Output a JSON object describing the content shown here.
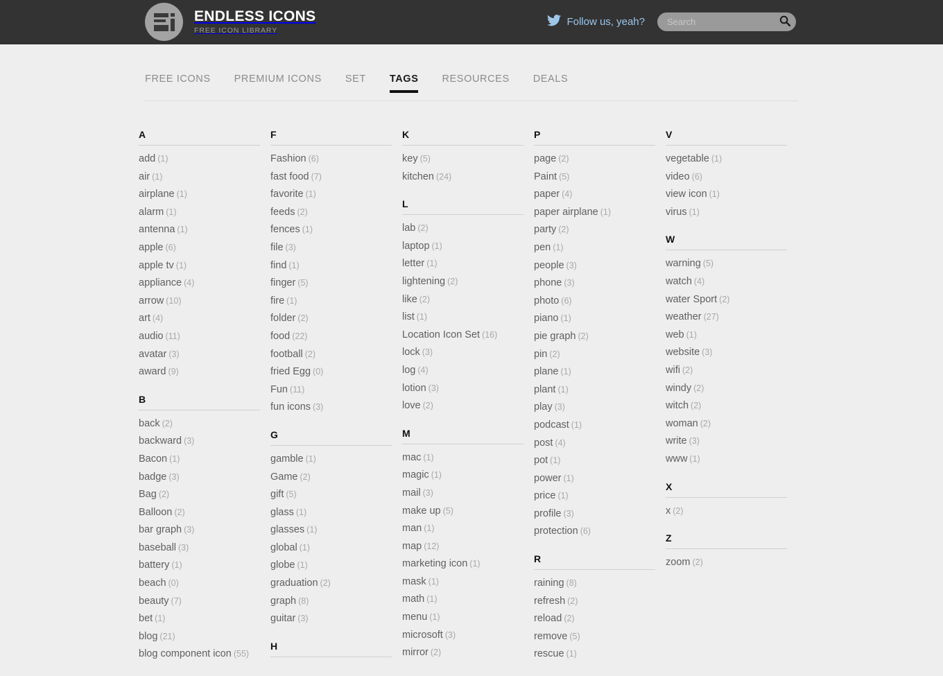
{
  "header": {
    "brand_title": "ENDLESS ICONS",
    "brand_subtitle": "FREE ICON LIBRARY",
    "logo_icon": "ei-monogram-icon",
    "twitter_icon": "twitter-bird-icon",
    "twitter_text": "Follow us, yeah?",
    "search_placeholder": "Search",
    "search_value": "",
    "search_icon": "search-icon",
    "colors": {
      "bar_background": "#333333",
      "logo_background": "#a3a3a3",
      "twitter_text": "#9ec6e8",
      "search_background": "#9a9a9a"
    }
  },
  "nav": {
    "items": [
      {
        "label": "FREE ICONS",
        "active": false
      },
      {
        "label": "PREMIUM ICONS",
        "active": false
      },
      {
        "label": "SET",
        "active": false
      },
      {
        "label": "TAGS",
        "active": true
      },
      {
        "label": "RESOURCES",
        "active": false
      },
      {
        "label": "DEALS",
        "active": false
      }
    ],
    "active_label": "TAGS",
    "active_underline_color": "#111111"
  },
  "page": {
    "background": "#eeeeee",
    "text_color": "#5f5f5f",
    "count_color": "#a8a8a8"
  },
  "columns": [
    {
      "blocks": [
        {
          "letter": "A",
          "tags": [
            {
              "name": "add",
              "count": "(1)"
            },
            {
              "name": "air",
              "count": "(1)"
            },
            {
              "name": "airplane",
              "count": "(1)"
            },
            {
              "name": "alarm",
              "count": "(1)"
            },
            {
              "name": "antenna",
              "count": "(1)"
            },
            {
              "name": "apple",
              "count": "(6)"
            },
            {
              "name": "apple tv",
              "count": "(1)"
            },
            {
              "name": "appliance",
              "count": "(4)"
            },
            {
              "name": "arrow",
              "count": "(10)"
            },
            {
              "name": "art",
              "count": "(4)"
            },
            {
              "name": "audio",
              "count": "(11)"
            },
            {
              "name": "avatar",
              "count": "(3)"
            },
            {
              "name": "award",
              "count": "(9)"
            }
          ]
        },
        {
          "letter": "B",
          "tags": [
            {
              "name": "back",
              "count": "(2)"
            },
            {
              "name": "backward",
              "count": "(3)"
            },
            {
              "name": "Bacon",
              "count": "(1)"
            },
            {
              "name": "badge",
              "count": "(3)"
            },
            {
              "name": "Bag",
              "count": "(2)"
            },
            {
              "name": "Balloon",
              "count": "(2)"
            },
            {
              "name": "bar graph",
              "count": "(3)"
            },
            {
              "name": "baseball",
              "count": "(3)"
            },
            {
              "name": "battery",
              "count": "(1)"
            },
            {
              "name": "beach",
              "count": "(0)"
            },
            {
              "name": "beauty",
              "count": "(7)"
            },
            {
              "name": "bet",
              "count": "(1)"
            },
            {
              "name": "blog",
              "count": "(21)"
            },
            {
              "name": "blog component icon",
              "count": "(55)"
            }
          ]
        }
      ]
    },
    {
      "blocks": [
        {
          "letter": "F",
          "tags": [
            {
              "name": "Fashion",
              "count": "(6)"
            },
            {
              "name": "fast food",
              "count": "(7)"
            },
            {
              "name": "favorite",
              "count": "(1)"
            },
            {
              "name": "feeds",
              "count": "(2)"
            },
            {
              "name": "fences",
              "count": "(1)"
            },
            {
              "name": "file",
              "count": "(3)"
            },
            {
              "name": "find",
              "count": "(1)"
            },
            {
              "name": "finger",
              "count": "(5)"
            },
            {
              "name": "fire",
              "count": "(1)"
            },
            {
              "name": "folder",
              "count": "(2)"
            },
            {
              "name": "food",
              "count": "(22)"
            },
            {
              "name": "football",
              "count": "(2)"
            },
            {
              "name": "fried Egg",
              "count": "(0)"
            },
            {
              "name": "Fun",
              "count": "(11)"
            },
            {
              "name": "fun icons",
              "count": "(3)"
            }
          ]
        },
        {
          "letter": "G",
          "tags": [
            {
              "name": "gamble",
              "count": "(1)"
            },
            {
              "name": "Game",
              "count": "(2)"
            },
            {
              "name": "gift",
              "count": "(5)"
            },
            {
              "name": "glass",
              "count": "(1)"
            },
            {
              "name": "glasses",
              "count": "(1)"
            },
            {
              "name": "global",
              "count": "(1)"
            },
            {
              "name": "globe",
              "count": "(1)"
            },
            {
              "name": "graduation",
              "count": "(2)"
            },
            {
              "name": "graph",
              "count": "(8)"
            },
            {
              "name": "guitar",
              "count": "(3)"
            }
          ]
        },
        {
          "letter": "H",
          "tags": []
        }
      ]
    },
    {
      "blocks": [
        {
          "letter": "K",
          "tags": [
            {
              "name": "key",
              "count": "(5)"
            },
            {
              "name": "kitchen",
              "count": "(24)"
            }
          ]
        },
        {
          "letter": "L",
          "tags": [
            {
              "name": "lab",
              "count": "(2)"
            },
            {
              "name": "laptop",
              "count": "(1)"
            },
            {
              "name": "letter",
              "count": "(1)"
            },
            {
              "name": "lightening",
              "count": "(2)"
            },
            {
              "name": "like",
              "count": "(2)"
            },
            {
              "name": "list",
              "count": "(1)"
            },
            {
              "name": "Location Icon Set",
              "count": "(16)"
            },
            {
              "name": "lock",
              "count": "(3)"
            },
            {
              "name": "log",
              "count": "(4)"
            },
            {
              "name": "lotion",
              "count": "(3)"
            },
            {
              "name": "love",
              "count": "(2)"
            }
          ]
        },
        {
          "letter": "M",
          "tags": [
            {
              "name": "mac",
              "count": "(1)"
            },
            {
              "name": "magic",
              "count": "(1)"
            },
            {
              "name": "mail",
              "count": "(3)"
            },
            {
              "name": "make up",
              "count": "(5)"
            },
            {
              "name": "man",
              "count": "(1)"
            },
            {
              "name": "map",
              "count": "(12)"
            },
            {
              "name": "marketing icon",
              "count": "(1)"
            },
            {
              "name": "mask",
              "count": "(1)"
            },
            {
              "name": "math",
              "count": "(1)"
            },
            {
              "name": "menu",
              "count": "(1)"
            },
            {
              "name": "microsoft",
              "count": "(3)"
            },
            {
              "name": "mirror",
              "count": "(2)"
            }
          ]
        }
      ]
    },
    {
      "blocks": [
        {
          "letter": "P",
          "tags": [
            {
              "name": "page",
              "count": "(2)"
            },
            {
              "name": "Paint",
              "count": "(5)"
            },
            {
              "name": "paper",
              "count": "(4)"
            },
            {
              "name": "paper airplane",
              "count": "(1)"
            },
            {
              "name": "party",
              "count": "(2)"
            },
            {
              "name": "pen",
              "count": "(1)"
            },
            {
              "name": "people",
              "count": "(3)"
            },
            {
              "name": "phone",
              "count": "(3)"
            },
            {
              "name": "photo",
              "count": "(6)"
            },
            {
              "name": "piano",
              "count": "(1)"
            },
            {
              "name": "pie graph",
              "count": "(2)"
            },
            {
              "name": "pin",
              "count": "(2)"
            },
            {
              "name": "plane",
              "count": "(1)"
            },
            {
              "name": "plant",
              "count": "(1)"
            },
            {
              "name": "play",
              "count": "(3)"
            },
            {
              "name": "podcast",
              "count": "(1)"
            },
            {
              "name": "post",
              "count": "(4)"
            },
            {
              "name": "pot",
              "count": "(1)"
            },
            {
              "name": "power",
              "count": "(1)"
            },
            {
              "name": "price",
              "count": "(1)"
            },
            {
              "name": "profile",
              "count": "(3)"
            },
            {
              "name": "protection",
              "count": "(6)"
            }
          ]
        },
        {
          "letter": "R",
          "tags": [
            {
              "name": "raining",
              "count": "(8)"
            },
            {
              "name": "refresh",
              "count": "(2)"
            },
            {
              "name": "reload",
              "count": "(2)"
            },
            {
              "name": "remove",
              "count": "(5)"
            },
            {
              "name": "rescue",
              "count": "(1)"
            }
          ]
        }
      ]
    },
    {
      "blocks": [
        {
          "letter": "V",
          "tags": [
            {
              "name": "vegetable",
              "count": "(1)"
            },
            {
              "name": "video",
              "count": "(6)"
            },
            {
              "name": "view icon",
              "count": "(1)"
            },
            {
              "name": "virus",
              "count": "(1)"
            }
          ]
        },
        {
          "letter": "W",
          "tags": [
            {
              "name": "warning",
              "count": "(5)"
            },
            {
              "name": "watch",
              "count": "(4)"
            },
            {
              "name": "water Sport",
              "count": "(2)"
            },
            {
              "name": "weather",
              "count": "(27)"
            },
            {
              "name": "web",
              "count": "(1)"
            },
            {
              "name": "website",
              "count": "(3)"
            },
            {
              "name": "wifi",
              "count": "(2)"
            },
            {
              "name": "windy",
              "count": "(2)"
            },
            {
              "name": "witch",
              "count": "(2)"
            },
            {
              "name": "woman",
              "count": "(2)"
            },
            {
              "name": "write",
              "count": "(3)"
            },
            {
              "name": "www",
              "count": "(1)"
            }
          ]
        },
        {
          "letter": "X",
          "tags": [
            {
              "name": "x",
              "count": "(2)"
            }
          ]
        },
        {
          "letter": "Z",
          "tags": [
            {
              "name": "zoom",
              "count": "(2)"
            }
          ]
        }
      ]
    }
  ]
}
